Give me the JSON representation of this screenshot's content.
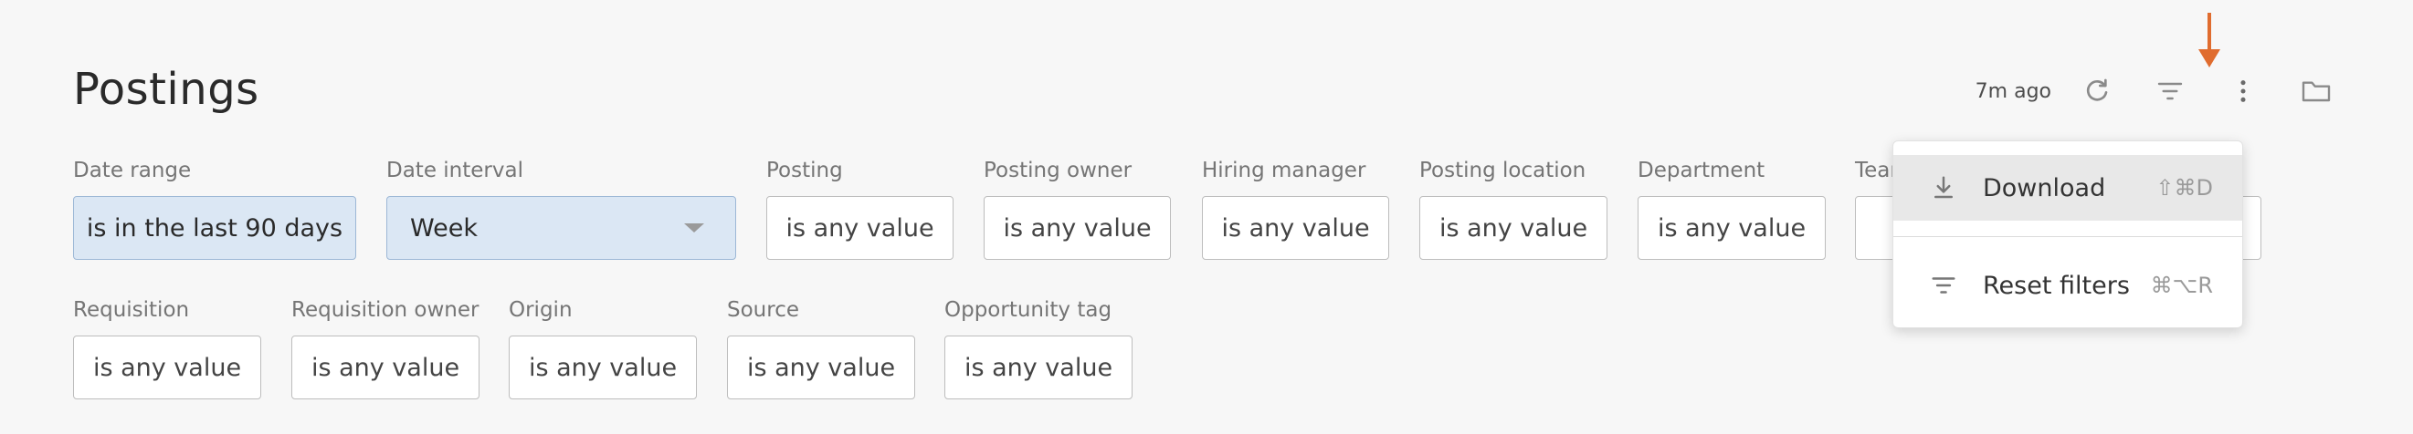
{
  "page": {
    "title": "Postings"
  },
  "toolbar": {
    "updated_text": "7m ago"
  },
  "filters": {
    "date_range": {
      "label": "Date range",
      "value": "is in the last 90 days"
    },
    "date_interval": {
      "label": "Date interval",
      "value": "Week"
    },
    "posting": {
      "label": "Posting",
      "value": "is any value"
    },
    "posting_owner": {
      "label": "Posting owner",
      "value": "is any value"
    },
    "hiring_manager": {
      "label": "Hiring manager",
      "value": "is any value"
    },
    "posting_location": {
      "label": "Posting location",
      "value": "is any value"
    },
    "department": {
      "label": "Department",
      "value": "is any value"
    },
    "team": {
      "label": "Tean",
      "value": "i"
    },
    "requisition": {
      "label": "Requisition",
      "value": "is any value"
    },
    "requisition_owner": {
      "label": "Requisition owner",
      "value": "is any value"
    },
    "origin": {
      "label": "Origin",
      "value": "is any value"
    },
    "source": {
      "label": "Source",
      "value": "is any value"
    },
    "opportunity_tag": {
      "label": "Opportunity tag",
      "value": "is any value"
    }
  },
  "menu": {
    "download": {
      "label": "Download",
      "shortcut": "⇧⌘D"
    },
    "reset": {
      "label": "Reset filters",
      "shortcut": "⌘⌥R"
    }
  },
  "colors": {
    "accent_arrow": "#e06c2e",
    "active_filter_bg": "#dbe7f4"
  },
  "icons": [
    "refresh-icon",
    "filter-icon",
    "more-vertical-icon",
    "folder-icon",
    "download-icon",
    "filter-lines-icon",
    "arrow-down-icon"
  ]
}
